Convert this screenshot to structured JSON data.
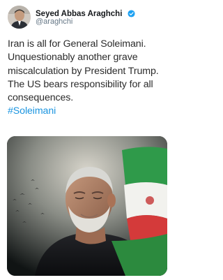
{
  "author": {
    "display_name": "Seyed Abbas Araghchi",
    "handle": "@araghchi",
    "verified": true,
    "avatar_icon": "profile-photo",
    "verified_icon": "verified-badge-icon"
  },
  "tweet": {
    "lines": [
      "Iran is all for General Soleimani.",
      "Unquestionably another grave",
      "miscalculation by President Trump.",
      "The US bears responsibility for all",
      "consequences."
    ],
    "hashtag": "#Soleimani"
  },
  "media": {
    "description_icon": "photo-image"
  },
  "colors": {
    "link": "#1b95e0",
    "verified": "#1da1f2",
    "handle": "#657786",
    "text": "#14171a"
  }
}
